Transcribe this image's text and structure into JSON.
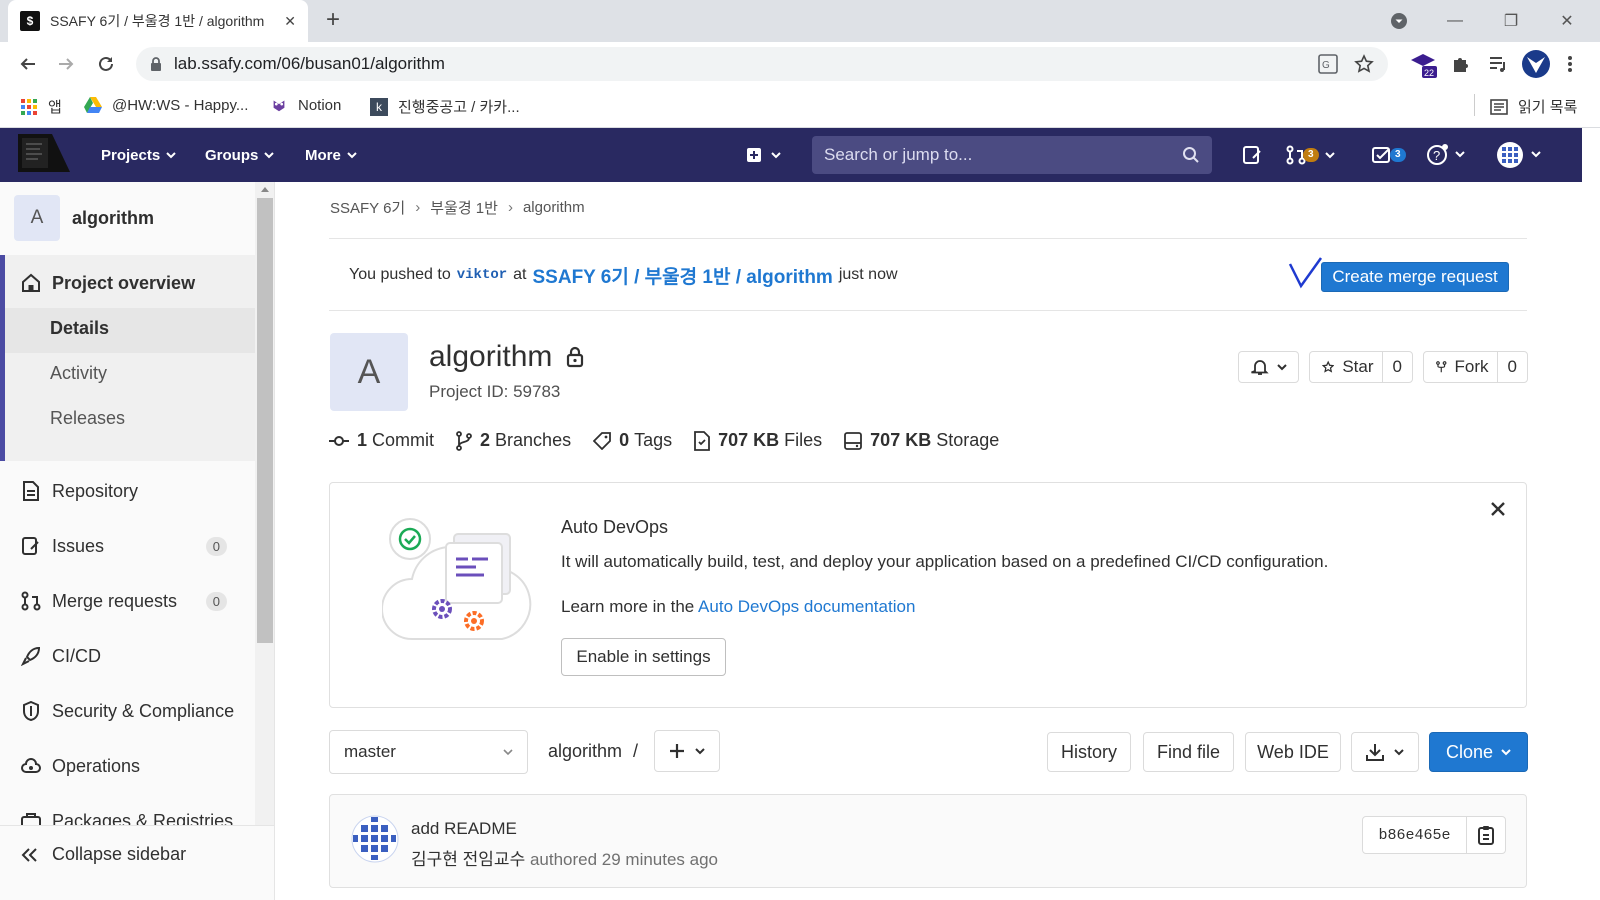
{
  "browser": {
    "tab_title": "SSAFY 6기 / 부울경 1반 / algorithm",
    "tab_favicon": "$",
    "new_tab": "+",
    "url": "lab.ssafy.com/06/busan01/algorithm",
    "extension_badge": "22",
    "bookmarks": [
      {
        "label": "앱",
        "icon": "apps-grid-icon"
      },
      {
        "label": "@HW:WS - Happy...",
        "icon": "google-drive-icon"
      },
      {
        "label": "Notion",
        "icon": "notion-icon"
      },
      {
        "label": "진행중공고 / 카카...",
        "icon": "kakao-k-icon"
      }
    ],
    "reading_list": "읽기 목록"
  },
  "gitlab_nav": {
    "menus": [
      "Projects",
      "Groups",
      "More"
    ],
    "search_placeholder": "Search or jump to...",
    "merge_requests_count": "3",
    "todos_count": "3"
  },
  "sidebar": {
    "project_initial": "A",
    "project_name": "algorithm",
    "overview": "Project overview",
    "overview_items": [
      "Details",
      "Activity",
      "Releases"
    ],
    "items": [
      {
        "label": "Repository",
        "icon": "document-icon"
      },
      {
        "label": "Issues",
        "icon": "issues-icon",
        "count": "0"
      },
      {
        "label": "Merge requests",
        "icon": "merge-request-icon",
        "count": "0"
      },
      {
        "label": "CI/CD",
        "icon": "rocket-icon"
      },
      {
        "label": "Security & Compliance",
        "icon": "shield-icon"
      },
      {
        "label": "Operations",
        "icon": "cloud-gear-icon"
      },
      {
        "label": "Packages & Registries",
        "icon": "package-icon"
      }
    ],
    "collapse": "Collapse sidebar"
  },
  "breadcrumb": [
    "SSAFY 6기",
    "부울경 1반",
    "algorithm"
  ],
  "push_notice": {
    "prefix": "You pushed to",
    "branch": "viktor",
    "at": "at",
    "path": "SSAFY 6기 / 부울경 1반 / algorithm",
    "suffix": "just now",
    "button": "Create merge request"
  },
  "project": {
    "initial": "A",
    "name": "algorithm",
    "id_label": "Project ID: 59783",
    "star_label": "Star",
    "star_count": "0",
    "fork_label": "Fork",
    "fork_count": "0"
  },
  "stats": [
    {
      "value": "1",
      "label": "Commit",
      "icon": "commit-icon"
    },
    {
      "value": "2",
      "label": "Branches",
      "icon": "branch-icon"
    },
    {
      "value": "0",
      "label": "Tags",
      "icon": "tag-icon"
    },
    {
      "value": "707 KB",
      "label": "Files",
      "icon": "file-icon"
    },
    {
      "value": "707 KB",
      "label": "Storage",
      "icon": "storage-icon"
    }
  ],
  "auto_devops": {
    "title": "Auto DevOps",
    "text": "It will automatically build, test, and deploy your application based on a predefined CI/CD configuration.",
    "learn_prefix": "Learn more in the",
    "learn_link": "Auto DevOps documentation",
    "button": "Enable in settings"
  },
  "repo_toolbar": {
    "branch": "master",
    "path": "algorithm",
    "path_sep": "/",
    "history": "History",
    "find_file": "Find file",
    "web_ide": "Web IDE",
    "clone": "Clone"
  },
  "last_commit": {
    "message": "add README",
    "author": "김구현 전임교수",
    "authored": "authored 29 minutes ago",
    "sha": "b86e465e"
  }
}
